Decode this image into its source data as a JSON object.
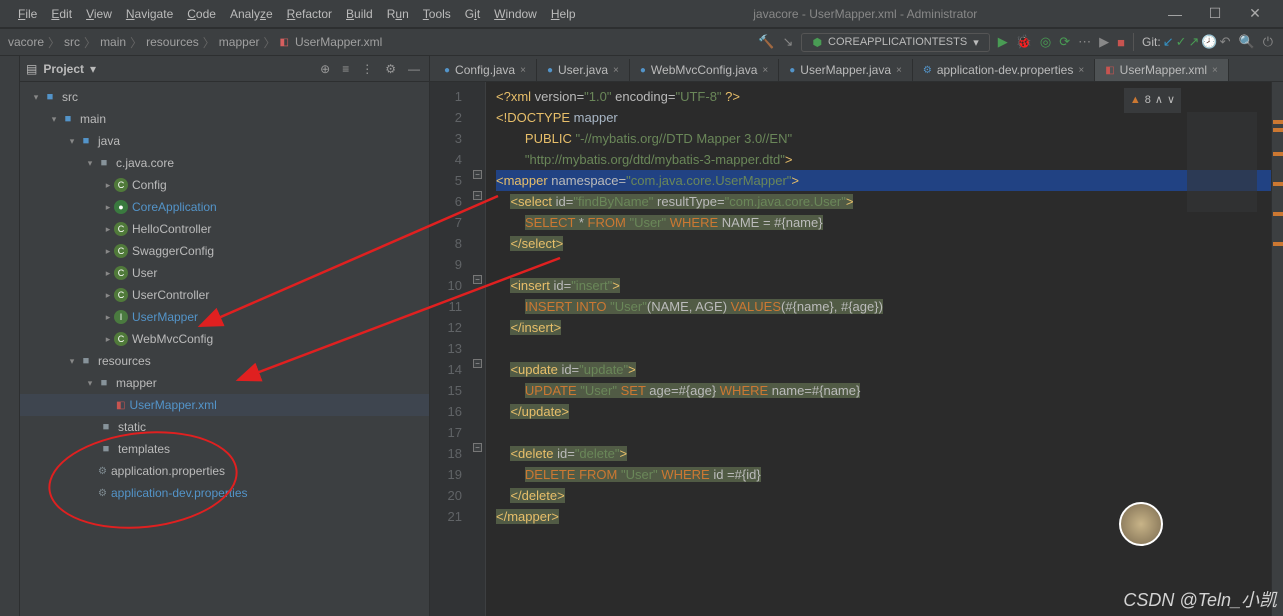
{
  "window": {
    "title": "javacore - UserMapper.xml - Administrator"
  },
  "menu": [
    "File",
    "Edit",
    "View",
    "Navigate",
    "Code",
    "Analyze",
    "Refactor",
    "Build",
    "Run",
    "Tools",
    "Git",
    "Window",
    "Help"
  ],
  "breadcrumb": [
    "vacore",
    "src",
    "main",
    "resources",
    "mapper",
    "UserMapper.xml"
  ],
  "run_config": "COREAPPLICATIONTESTS",
  "git_label": "Git:",
  "project_panel": {
    "title": "Project"
  },
  "tree": {
    "src": "src",
    "main": "main",
    "java": "java",
    "pkg": "c.java.core",
    "config": "Config",
    "coreapp": "CoreApplication",
    "hello": "HelloController",
    "swagger": "SwaggerConfig",
    "user": "User",
    "userctrl": "UserController",
    "usermapper": "UserMapper",
    "webmvc": "WebMvcConfig",
    "resources": "resources",
    "mapper": "mapper",
    "usermapperxml": "UserMapper.xml",
    "static": "static",
    "templates": "templates",
    "appprops": "application.properties",
    "appdevprops": "application-dev.properties"
  },
  "tabs": [
    {
      "label": "Config.java",
      "type": "java",
      "active": false
    },
    {
      "label": "User.java",
      "type": "java",
      "active": false
    },
    {
      "label": "WebMvcConfig.java",
      "type": "java",
      "active": false
    },
    {
      "label": "UserMapper.java",
      "type": "java",
      "active": false
    },
    {
      "label": "application-dev.properties",
      "type": "props",
      "active": false
    },
    {
      "label": "UserMapper.xml",
      "type": "xml",
      "active": true
    }
  ],
  "warnings_count": "8",
  "code_lines": [
    1,
    2,
    3,
    4,
    5,
    6,
    7,
    8,
    9,
    10,
    11,
    12,
    13,
    14,
    15,
    16,
    17,
    18,
    19,
    20,
    21
  ],
  "code": {
    "l1": "<?xml version=\"1.0\" encoding=\"UTF-8\" ?>",
    "l2": "<!DOCTYPE mapper",
    "l3_pub": "        PUBLIC ",
    "l3_str": "\"-//mybatis.org//DTD Mapper 3.0//EN\"",
    "l4": "        \"http://mybatis.org/dtd/mybatis-3-mapper.dtd\">",
    "l5_open": "<mapper ",
    "l5_ns": "namespace=",
    "l5_val": "\"com.java.core.UserMapper\"",
    "l5_close": ">",
    "l6_open": "    <select ",
    "l6_id": "id=",
    "l6_idv": "\"findByName\"",
    "l6_rt": " resultType=",
    "l6_rtv": "\"com.java.core.User\"",
    "l6_end": ">",
    "l7": "        SELECT * FROM \"User\" WHERE NAME = #{name}",
    "l8": "    </select>",
    "l10_open": "    <insert ",
    "l10_id": "id=",
    "l10_idv": "\"insert\"",
    "l10_end": ">",
    "l11": "        INSERT INTO \"User\"(NAME, AGE) VALUES(#{name}, #{age})",
    "l12": "    </insert>",
    "l14_open": "    <update ",
    "l14_id": "id=",
    "l14_idv": "\"update\"",
    "l14_end": ">",
    "l15": "        UPDATE \"User\" SET age=#{age} WHERE name=#{name}",
    "l16": "    </update>",
    "l18_open": "    <delete ",
    "l18_id": "id=",
    "l18_idv": "\"delete\"",
    "l18_end": ">",
    "l19": "        DELETE FROM \"User\" WHERE id =#{id}",
    "l20": "    </delete>",
    "l21": "</mapper>"
  },
  "watermark": "CSDN @Teln_小凯"
}
